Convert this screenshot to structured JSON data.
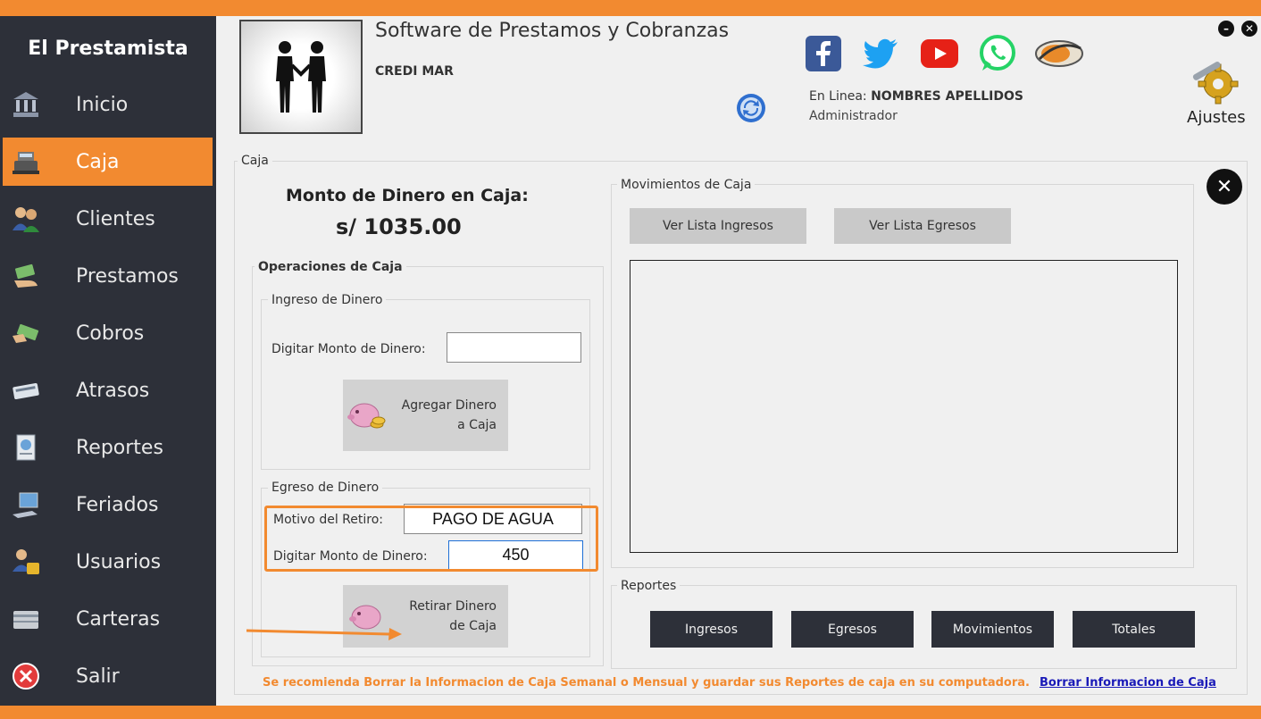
{
  "sidebar": {
    "brand": "El Prestamista",
    "items": [
      {
        "label": "Inicio",
        "icon": "bank-icon",
        "active": false
      },
      {
        "label": "Caja",
        "icon": "cash-register-icon",
        "active": true
      },
      {
        "label": "Clientes",
        "icon": "users-icon",
        "active": false
      },
      {
        "label": "Prestamos",
        "icon": "money-hand-icon",
        "active": false
      },
      {
        "label": "Cobros",
        "icon": "money-icon",
        "active": false
      },
      {
        "label": "Atrasos",
        "icon": "calendar-icon",
        "active": false
      },
      {
        "label": "Reportes",
        "icon": "report-icon",
        "active": false
      },
      {
        "label": "Feriados",
        "icon": "computer-icon",
        "active": false
      },
      {
        "label": "Usuarios",
        "icon": "user-lock-icon",
        "active": false
      },
      {
        "label": "Carteras",
        "icon": "wallet-icon",
        "active": false
      },
      {
        "label": "Salir",
        "icon": "exit-icon",
        "active": false
      }
    ]
  },
  "header": {
    "title": "Software de Prestamos y Cobranzas",
    "company": "CREDI MAR",
    "online_prefix": "En Linea:",
    "online_user": "NOMBRES APELLIDOS",
    "role": "Administrador",
    "settings_label": "Ajustes"
  },
  "caja": {
    "group_title": "Caja",
    "monto_label": "Monto de Dinero en Caja:",
    "monto_value": "s/  1035.00",
    "operaciones_title": "Operaciones de Caja",
    "ingreso": {
      "title": "Ingreso de Dinero",
      "monto_label": "Digitar Monto de Dinero:",
      "monto_value": "",
      "button_line1": "Agregar Dinero",
      "button_line2": "a Caja"
    },
    "egreso": {
      "title": "Egreso de Dinero",
      "motivo_label": "Motivo del Retiro:",
      "motivo_value": "PAGO DE AGUA",
      "monto_label": "Digitar Monto de Dinero:",
      "monto_value": "450",
      "button_line1": "Retirar Dinero",
      "button_line2": "de Caja"
    },
    "movimientos": {
      "title": "Movimientos de Caja",
      "ver_ingresos": "Ver Lista Ingresos",
      "ver_egresos": "Ver Lista Egresos"
    },
    "reportes": {
      "title": "Reportes",
      "buttons": [
        "Ingresos",
        "Egresos",
        "Movimientos",
        "Totales"
      ]
    },
    "footer_note": "Se recomienda Borrar la Informacion de Caja Semanal o Mensual y guardar sus Reportes de caja en su computadora.",
    "footer_link": "Borrar Informacion de Caja"
  },
  "colors": {
    "accent": "#f28a30",
    "sidebar_bg": "#2d3039",
    "link": "#1a1ab8"
  }
}
